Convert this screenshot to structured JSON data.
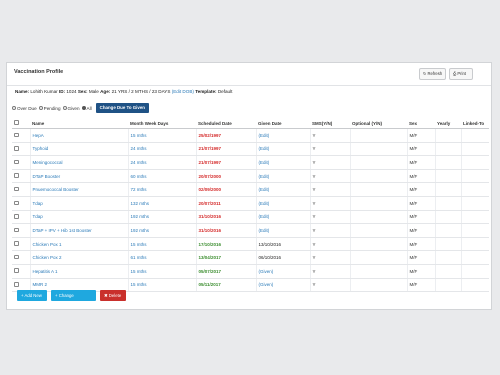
{
  "panel": {
    "title": "Vaccination Profile",
    "refresh_label": "Refresh",
    "print_label": "Print"
  },
  "patient": {
    "name_label": "Name:",
    "name": "Lohith Kumar",
    "id_label": "ID:",
    "id": "1024",
    "sex_label": "Sex:",
    "sex": "Male",
    "age_label": "Age:",
    "age": "21 YRS / 2 MTHS / 23 DAYS",
    "edit_dob": "(Edit DOB)",
    "template_label": "Template:",
    "template": "Default"
  },
  "filters": {
    "options": [
      "Over Due",
      "Pending",
      "Given",
      "All"
    ],
    "selected": "All",
    "change_due_label": "Change Due To Given"
  },
  "table": {
    "headers": [
      "Name",
      "Month Week Days",
      "Scheduled Date",
      "Given Date",
      "SMS(Y/N)",
      "Optional (Y/N)",
      "Sex",
      "Yearly",
      "Linked-To"
    ],
    "rows": [
      {
        "name": "HepA",
        "mwd": "15 mths",
        "scheduled": "25/02/1997",
        "sched_color": "red",
        "given": "(Edit)",
        "sms": "Y",
        "optional": "",
        "sex": "M/F",
        "yearly": "",
        "linked": ""
      },
      {
        "name": "Typhoid",
        "mwd": "24 mths",
        "scheduled": "21/07/1997",
        "sched_color": "red",
        "given": "(Edit)",
        "sms": "Y",
        "optional": "",
        "sex": "M/F",
        "yearly": "",
        "linked": ""
      },
      {
        "name": "Meningococcal",
        "mwd": "24 mths",
        "scheduled": "21/07/1997",
        "sched_color": "red",
        "given": "(Edit)",
        "sms": "Y",
        "optional": "",
        "sex": "M/F",
        "yearly": "",
        "linked": ""
      },
      {
        "name": "DTaP Booster",
        "mwd": "60 mths",
        "scheduled": "20/07/2000",
        "sched_color": "red",
        "given": "(Edit)",
        "sms": "Y",
        "optional": "",
        "sex": "M/F",
        "yearly": "",
        "linked": ""
      },
      {
        "name": "Pnuemococcal Booster",
        "mwd": "72 mths",
        "scheduled": "02/09/2000",
        "sched_color": "red",
        "given": "(Edit)",
        "sms": "Y",
        "optional": "",
        "sex": "M/F",
        "yearly": "",
        "linked": ""
      },
      {
        "name": "Tdap",
        "mwd": "132 mths",
        "scheduled": "20/07/2011",
        "sched_color": "red",
        "given": "(Edit)",
        "sms": "Y",
        "optional": "",
        "sex": "M/F",
        "yearly": "",
        "linked": ""
      },
      {
        "name": "Tdap",
        "mwd": "192 mths",
        "scheduled": "31/10/2016",
        "sched_color": "red",
        "given": "(Edit)",
        "sms": "Y",
        "optional": "",
        "sex": "M/F",
        "yearly": "",
        "linked": ""
      },
      {
        "name": "DTaP + IPV + Hib 1st Booster",
        "mwd": "192 mths",
        "scheduled": "31/10/2016",
        "sched_color": "red",
        "given": "(Edit)",
        "sms": "Y",
        "optional": "",
        "sex": "M/F",
        "yearly": "",
        "linked": ""
      },
      {
        "name": "Chicken Pox 1",
        "mwd": "15 mths",
        "scheduled": "17/10/2016",
        "sched_color": "green",
        "given": "13/10/2016",
        "sms": "Y",
        "optional": "",
        "sex": "M/F",
        "yearly": "",
        "linked": ""
      },
      {
        "name": "Chicken Pox 2",
        "mwd": "61 mths",
        "scheduled": "13/04/2017",
        "sched_color": "green",
        "given": "06/10/2016",
        "sms": "Y",
        "optional": "",
        "sex": "M/F",
        "yearly": "",
        "linked": ""
      },
      {
        "name": "Hepatitis A 1",
        "mwd": "15 mths",
        "scheduled": "05/07/2017",
        "sched_color": "green",
        "given": "(Given)",
        "sms": "Y",
        "optional": "",
        "sex": "M/F",
        "yearly": "",
        "linked": ""
      },
      {
        "name": "MMR 2",
        "mwd": "15 mths",
        "scheduled": "05/11/2017",
        "sched_color": "green",
        "given": "(Given)",
        "sms": "Y",
        "optional": "",
        "sex": "M/F",
        "yearly": "",
        "linked": ""
      }
    ]
  },
  "footer": {
    "add_new": "Add New",
    "change_template": "Change Template",
    "delete": "Delete"
  },
  "colors": {
    "link": "#2a7ab8",
    "overdue": "#d42a2a",
    "given": "#3a8d2e",
    "primary_dark": "#1f5285",
    "primary": "#1fa8df",
    "danger": "#c9302c"
  },
  "icons": {
    "refresh": "refresh-icon",
    "print": "print-icon",
    "add": "plus-icon",
    "delete": "trash-icon"
  }
}
